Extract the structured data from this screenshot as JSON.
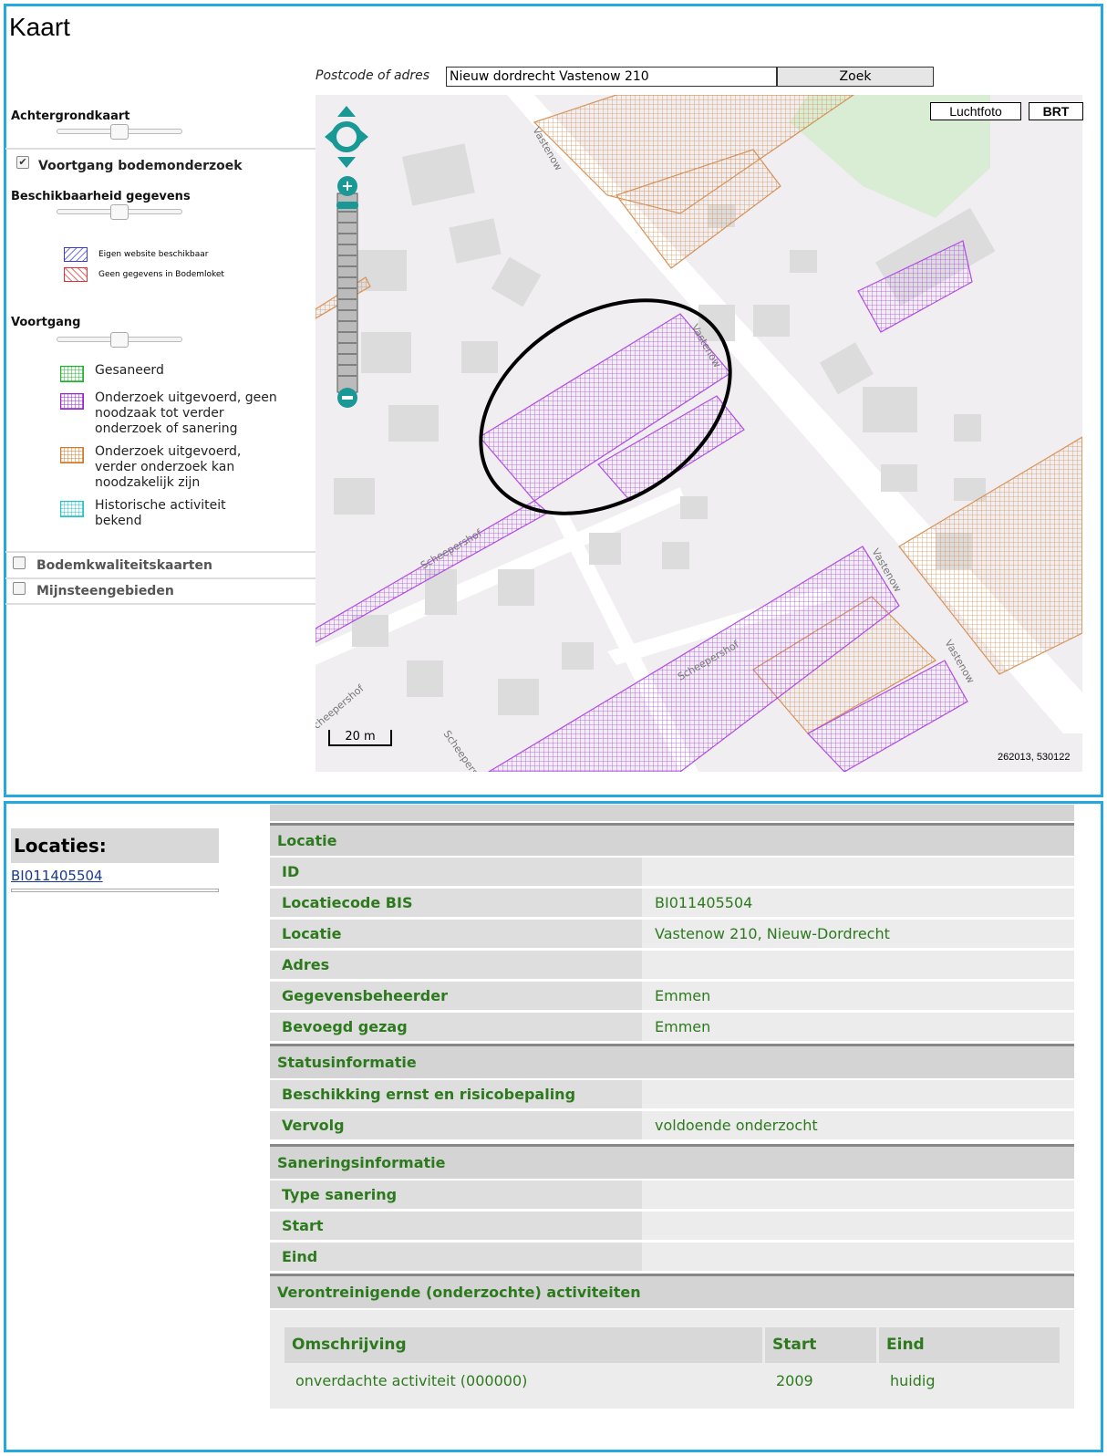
{
  "page": {
    "title": "Kaart"
  },
  "search": {
    "label": "Postcode of adres",
    "value": "Nieuw dordrecht Vastenow 210",
    "button": "Zoek"
  },
  "layers": {
    "background_label": "Achtergrondkaart",
    "voortgang_checkbox": "Voortgang bodemonderzoek",
    "voortgang_checked": true,
    "beschikbaarheid_label": "Beschikbaarheid gegevens",
    "small_legend": [
      {
        "label": "Eigen website beschikbaar",
        "color": "#3b3bd0"
      },
      {
        "label": "Geen gegevens in Bodemloket",
        "color": "#e03030"
      }
    ],
    "voortgang_label": "Voortgang",
    "legend": [
      {
        "label": "Gesaneerd",
        "color": "#1fb52a"
      },
      {
        "label": "Onderzoek uitgevoerd, geen noodzaak tot verder onderzoek of sanering",
        "color": "#9a1fd8"
      },
      {
        "label": "Onderzoek uitgevoerd, verder onderzoek kan noodzakelijk zijn",
        "color": "#d6782a"
      },
      {
        "label": "Historische activiteit bekend",
        "color": "#22c4c9"
      }
    ],
    "bodemkwaliteit": "Bodemkwaliteitskaarten",
    "mijnsteen": "Mijnsteengebieden"
  },
  "map": {
    "buttons": {
      "luchtfoto": "Luchtfoto",
      "brt": "BRT"
    },
    "scale": "20 m",
    "coords": "262013, 530122",
    "street_labels": [
      "Vastenow",
      "Vastenow",
      "Vastenow",
      "Vastenow",
      "Scheepershof",
      "Scheepershof",
      "Scheepershof",
      "Scheepershof"
    ],
    "colors": {
      "purple": "#b24ce6",
      "orange": "#d7935a",
      "green": "#d8edd3",
      "building": "#dcdcdc",
      "zoom": "#1a9896"
    }
  },
  "locaties": {
    "title": "Locaties:",
    "link": "BI011405504"
  },
  "details": {
    "locatie_section": "Locatie",
    "locatie_rows": [
      {
        "key": "ID",
        "value": ""
      },
      {
        "key": "Locatiecode BIS",
        "value": "BI011405504"
      },
      {
        "key": "Locatie",
        "value": "Vastenow 210, Nieuw-Dordrecht"
      },
      {
        "key": "Adres",
        "value": ""
      },
      {
        "key": "Gegevensbeheerder",
        "value": "Emmen"
      },
      {
        "key": "Bevoegd gezag",
        "value": "Emmen"
      }
    ],
    "status_section": "Statusinformatie",
    "status_rows": [
      {
        "key": "Beschikking ernst en risicobepaling",
        "value": ""
      },
      {
        "key": "Vervolg",
        "value": "voldoende onderzocht"
      }
    ],
    "sanering_section": "Saneringsinformatie",
    "sanering_rows": [
      {
        "key": "Type sanering",
        "value": ""
      },
      {
        "key": "Start",
        "value": ""
      },
      {
        "key": "Eind",
        "value": ""
      }
    ],
    "activiteiten_section": "Verontreinigende (onderzochte) activiteiten",
    "activiteiten_table": {
      "headers": [
        "Omschrijving",
        "Start",
        "Eind"
      ],
      "rows": [
        [
          "onverdachte activiteit (000000)",
          "2009",
          "huidig"
        ]
      ]
    }
  }
}
